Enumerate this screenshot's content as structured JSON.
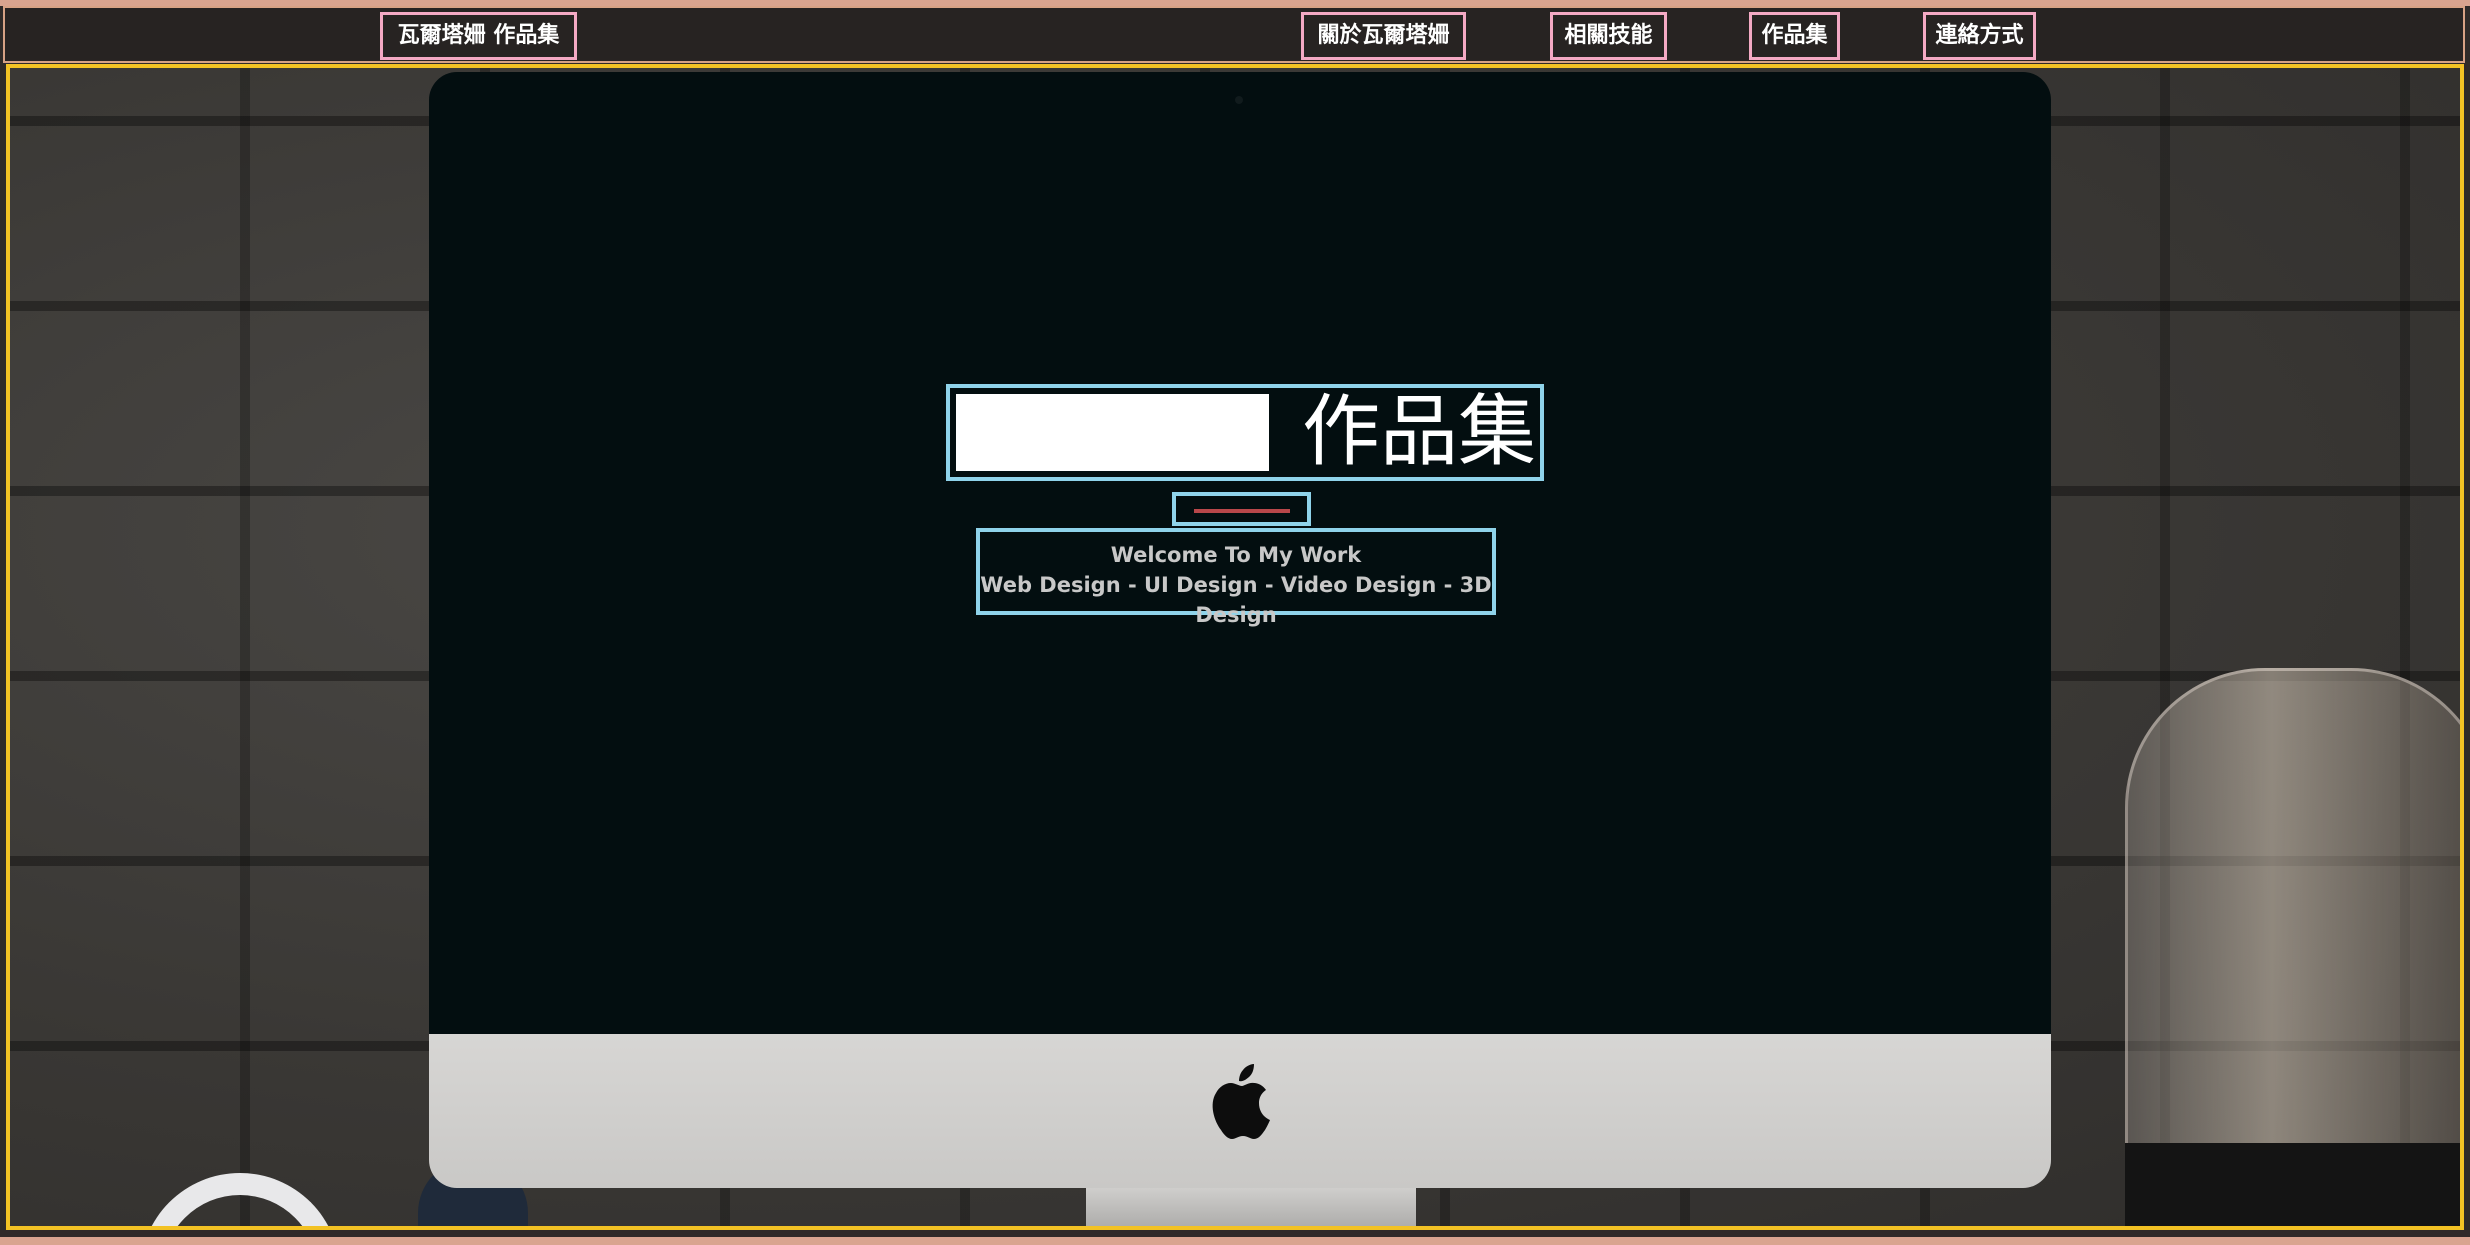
{
  "nav": {
    "brand": "瓦爾塔姍 作品集",
    "items": [
      "關於瓦爾塔姍",
      "相關技能",
      "作品集",
      "連絡方式"
    ]
  },
  "hero": {
    "title": "作品集",
    "welcome": "Welcome To My Work",
    "tagline": "Web Design - UI Design - Video Design - 3D Design"
  },
  "colors": {
    "navbar_bg": "#272322",
    "nav_outline": "#f4a9c4",
    "hero_outline": "#f3c224",
    "text_box_outline": "#8fd3ea",
    "divider": "#b8474a",
    "screen": "#030e10"
  },
  "icons": {
    "logo": "apple-logo-icon"
  }
}
